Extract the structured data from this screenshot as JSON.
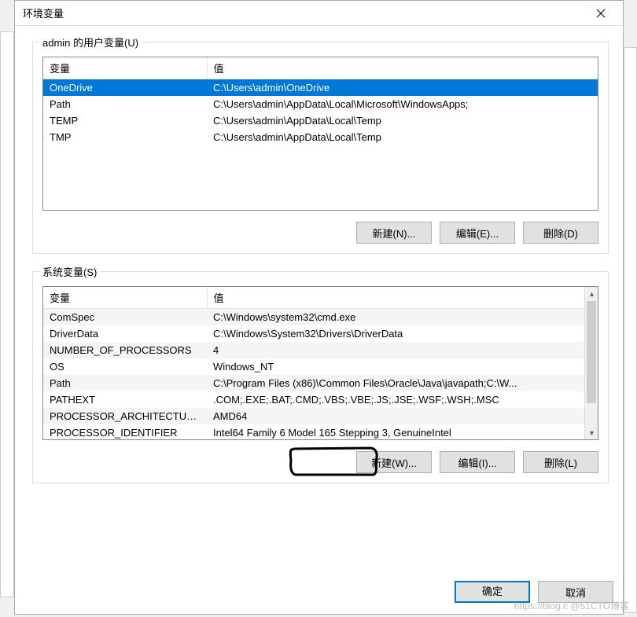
{
  "window": {
    "title": "环境变量"
  },
  "userGroup": {
    "label": "admin 的用户变量(U)",
    "columns": {
      "name": "变量",
      "value": "值"
    },
    "rows": [
      {
        "name": "OneDrive",
        "value": "C:\\Users\\admin\\OneDrive",
        "selected": true
      },
      {
        "name": "Path",
        "value": "C:\\Users\\admin\\AppData\\Local\\Microsoft\\WindowsApps;",
        "selected": false
      },
      {
        "name": "TEMP",
        "value": "C:\\Users\\admin\\AppData\\Local\\Temp",
        "selected": false
      },
      {
        "name": "TMP",
        "value": "C:\\Users\\admin\\AppData\\Local\\Temp",
        "selected": false
      }
    ],
    "buttons": {
      "new": "新建(N)...",
      "edit": "编辑(E)...",
      "delete": "删除(D)"
    }
  },
  "sysGroup": {
    "label": "系统变量(S)",
    "columns": {
      "name": "变量",
      "value": "值"
    },
    "rows": [
      {
        "name": "ComSpec",
        "value": "C:\\Windows\\system32\\cmd.exe"
      },
      {
        "name": "DriverData",
        "value": "C:\\Windows\\System32\\Drivers\\DriverData"
      },
      {
        "name": "NUMBER_OF_PROCESSORS",
        "value": "4"
      },
      {
        "name": "OS",
        "value": "Windows_NT"
      },
      {
        "name": "Path",
        "value": "C:\\Program Files (x86)\\Common Files\\Oracle\\Java\\javapath;C:\\W..."
      },
      {
        "name": "PATHEXT",
        "value": ".COM;.EXE;.BAT;.CMD;.VBS;.VBE;.JS;.JSE;.WSF;.WSH;.MSC"
      },
      {
        "name": "PROCESSOR_ARCHITECTURE",
        "value": "AMD64"
      },
      {
        "name": "PROCESSOR_IDENTIFIER",
        "value": "Intel64 Family 6 Model 165 Stepping 3, GenuineIntel"
      }
    ],
    "buttons": {
      "new": "新建(W)...",
      "edit": "编辑(I)...",
      "delete": "删除(L)"
    }
  },
  "dialog": {
    "ok": "确定",
    "cancel": "取消"
  },
  "watermark": "https://blog.c @51CTO博客"
}
